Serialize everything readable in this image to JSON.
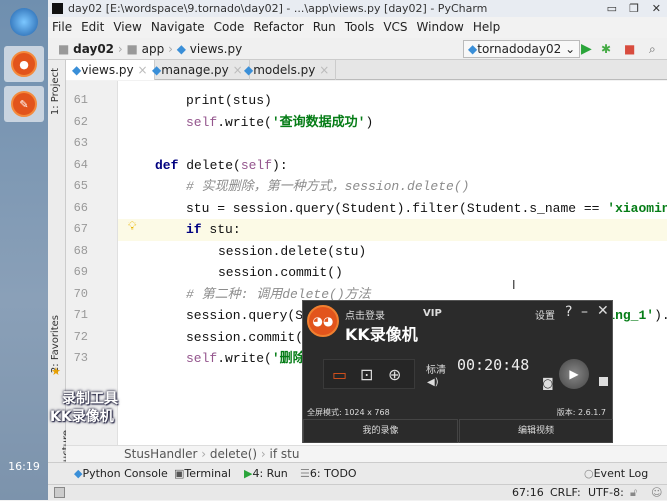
{
  "taskbar": {
    "clock": "16:19",
    "watermark_line1": "录制工具",
    "watermark_line2": "KK录像机"
  },
  "window": {
    "title": "day02 [E:\\wordspace\\9.tornado\\day02] - ...\\app\\views.py [day02] - PyCharm"
  },
  "menu": [
    "File",
    "Edit",
    "View",
    "Navigate",
    "Code",
    "Refactor",
    "Run",
    "Tools",
    "VCS",
    "Window",
    "Help"
  ],
  "nav": {
    "crumbs": [
      "day02",
      "app",
      "views.py"
    ],
    "run_config": "tornadoday02"
  },
  "tabs": [
    "views.py",
    "manage.py",
    "models.py"
  ],
  "side_tools": {
    "project": "1: Project",
    "favorites": "2: Favorites",
    "structure": "Z: Structure"
  },
  "code": [
    {
      "n": "61",
      "indent": 2,
      "parts": [
        [
          "",
          "print(stus)"
        ]
      ]
    },
    {
      "n": "62",
      "indent": 2,
      "parts": [
        [
          "sf",
          "self"
        ],
        [
          "",
          ".write("
        ],
        [
          "st",
          "'查询数据成功'"
        ],
        [
          "",
          ")"
        ]
      ]
    },
    {
      "n": "63",
      "indent": 0,
      "parts": []
    },
    {
      "n": "64",
      "indent": 1,
      "parts": [
        [
          "kw",
          "def"
        ],
        [
          "",
          " delete("
        ],
        [
          "sf",
          "self"
        ],
        [
          "",
          "):"
        ]
      ]
    },
    {
      "n": "65",
      "indent": 2,
      "parts": [
        [
          "cm",
          "# 实现删除，第一种方式，session.delete()"
        ]
      ]
    },
    {
      "n": "66",
      "indent": 2,
      "parts": [
        [
          "",
          "stu = session.query(Student).filter(Student.s_name == "
        ],
        [
          "st",
          "'xiaoming"
        ]
      ]
    },
    {
      "n": "67",
      "indent": 2,
      "parts": [
        [
          "kw",
          "if"
        ],
        [
          "",
          " stu:"
        ]
      ]
    },
    {
      "n": "68",
      "indent": 3,
      "parts": [
        [
          "",
          "session.delete(stu)"
        ]
      ]
    },
    {
      "n": "69",
      "indent": 3,
      "parts": [
        [
          "",
          "session.commit()"
        ]
      ]
    },
    {
      "n": "70",
      "indent": 2,
      "parts": [
        [
          "cm",
          "# 第二种: 调用delete()方法"
        ]
      ]
    },
    {
      "n": "71",
      "indent": 2,
      "parts": [
        [
          "",
          "session.query(Student).filter(Student.s_name == "
        ],
        [
          "st",
          "'xiaoming_1'"
        ],
        [
          "",
          ")."
        ]
      ]
    },
    {
      "n": "72",
      "indent": 2,
      "parts": [
        [
          "",
          "session.commit()"
        ]
      ]
    },
    {
      "n": "73",
      "indent": 2,
      "parts": [
        [
          "sf",
          "self"
        ],
        [
          "",
          ".write("
        ],
        [
          "st",
          "'删除成功'"
        ],
        [
          "",
          ")"
        ]
      ]
    }
  ],
  "breadcrumb": [
    "StusHandler",
    "delete()",
    "if stu"
  ],
  "tool_windows": [
    "Python Console",
    "Terminal",
    "4: Run",
    "6: TODO",
    "Event Log"
  ],
  "status": {
    "position": "67:16",
    "line_sep": "CRLF",
    "encoding": "UTF-8"
  },
  "kk": {
    "login": "点击登录",
    "vip": "VIP",
    "settings": "设置",
    "title": "KK录像机",
    "quality": "标清",
    "timer": "00:20:48",
    "mode": "全屏模式: 1024 x 768",
    "version": "版本: 2.6.1.7",
    "my_videos": "我的录像",
    "edit_video": "编辑视频",
    "accent": "#e2541c"
  }
}
